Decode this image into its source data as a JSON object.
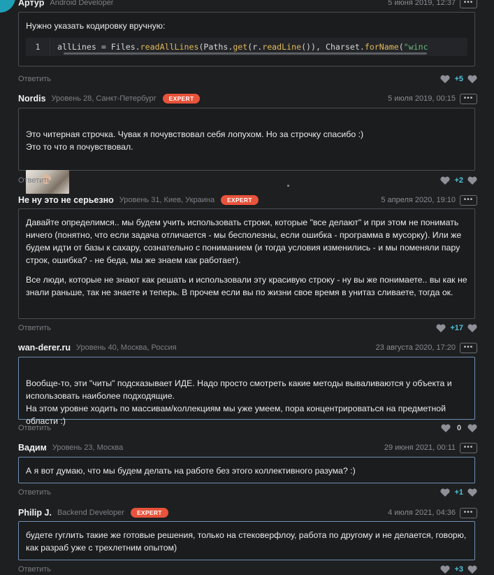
{
  "reply_label": "Ответить",
  "comments": [
    {
      "author": "Артур",
      "meta": "Android Developer",
      "badge": "",
      "date": "5 июня 2019, 12:37",
      "paragraphs": [
        "Нужно указать кодировку вручную:"
      ],
      "code": {
        "line": "1",
        "text": "allLines = Files.readAllLines(Paths.get(r.readLine()), Charset.forName(\"winc"
      },
      "score": "+5"
    },
    {
      "author": "Nordis",
      "meta": "Уровень 28, Санкт-Петербург",
      "badge": "EXPERT",
      "date": "5 июля 2019, 00:15",
      "paragraphs": [
        "Это читерная строчка. Чувак я почувствовал себя лопухом. Но за строчку спасибо :)\nЭто то что я почувствовал."
      ],
      "score": "+2"
    },
    {
      "author": "Не ну это не серьезно",
      "meta": "Уровень 31, Киев, Украина",
      "badge": "EXPERT",
      "date": "5 апреля 2020, 19:10",
      "paragraphs": [
        "Давайте определимся.. мы будем учить использовать строки, которые \"все делают\" и при этом не понимать ничего (понятно, что если задача отличается - мы бесполезны, если ошибка - программа в мусорку). Или же будем идти от базы к сахару, сознательно с пониманием (и тогда условия изменились - и мы поменяли пару строк, ошибка? - не беда, мы же знаем как работает).",
        "Все люди, которые не знают как решать и использовали эту красивую строку - ну вы же понимаете.. вы как не знали раньше, так не знаете и теперь. В прочем если вы по жизни свое время в унитаз сливаете, тогда ок."
      ],
      "score": "+17"
    },
    {
      "author": "wan-derer.ru",
      "meta": "Уровень 40, Москва, Россия",
      "badge": "",
      "date": "23 августа 2020, 17:20",
      "paragraphs": [
        "Вообще-то, эти \"читы\" подсказывает ИДЕ. Надо просто смотреть какие методы вываливаются у объекта и использовать наиболее подходящие.\nНа этом уровне ходить по массивам/коллекциям мы уже умеем, пора концентрироваться на предметной области :)"
      ],
      "score": "0"
    },
    {
      "author": "Вадим",
      "meta": "Уровень 23, Москва",
      "badge": "",
      "date": "29 июня 2021, 00:11",
      "paragraphs": [
        "А я вот думаю, что мы будем делать на работе без этого коллективного разума? :)"
      ],
      "score": "+1"
    },
    {
      "author": "Philip J.",
      "meta": "Backend Developer",
      "badge": "EXPERT",
      "date": "4 июля 2021, 04:36",
      "paragraphs": [
        "будете гуглить такие же готовые решения, только на стековерфлоу, работа по другому и не делается, говорю, как разраб уже с трехлетним опытом)"
      ],
      "score": "+3"
    }
  ],
  "colors": {
    "background": "#1e1f21",
    "badge": "#e8533b",
    "score": "#4fc3d9",
    "accent": "#1f9fb5"
  },
  "icons": {
    "like": "heart-icon",
    "more": "ellipsis-icon"
  }
}
